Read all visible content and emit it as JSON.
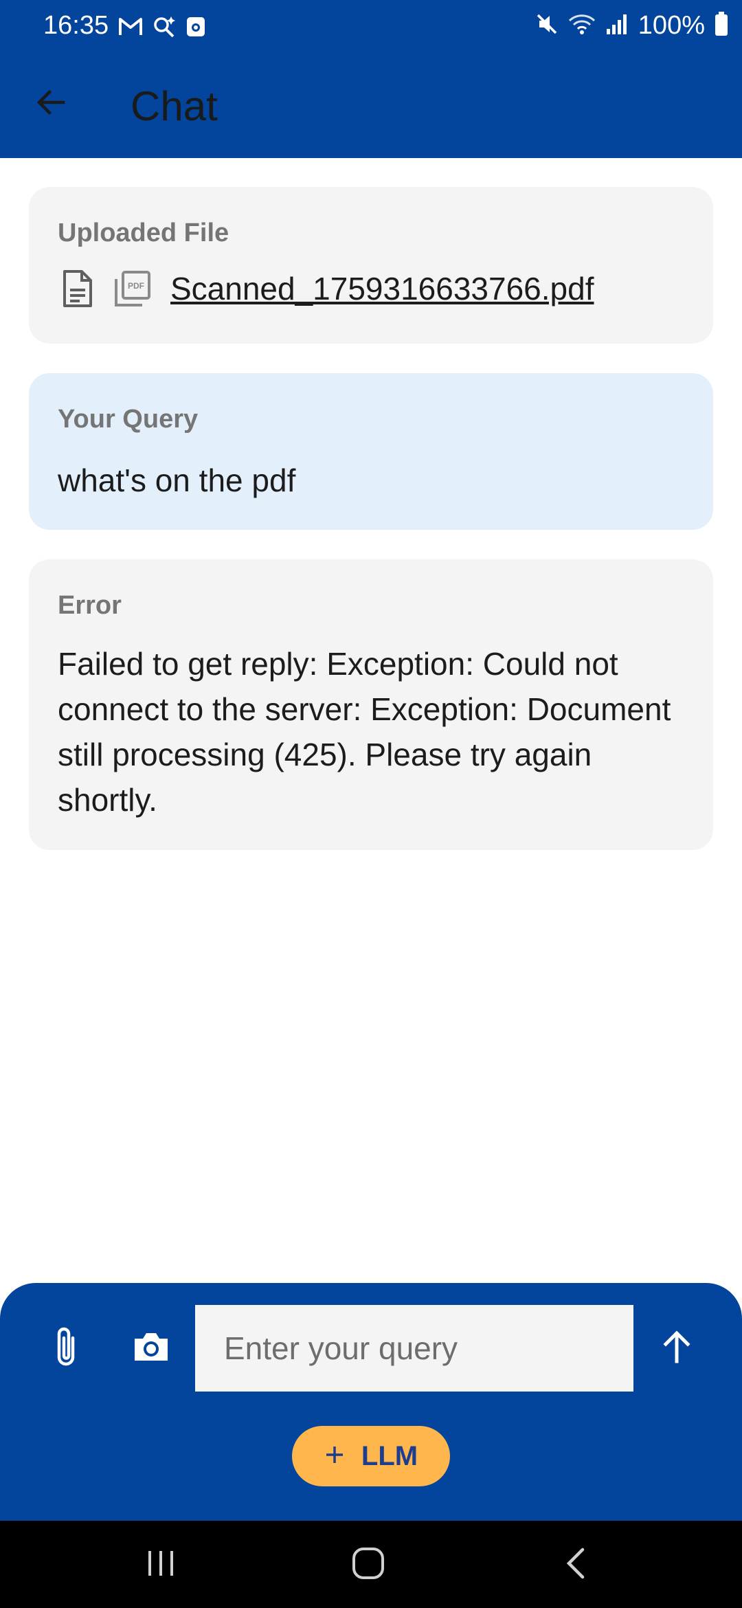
{
  "status_bar": {
    "time": "16:35",
    "left_icons": [
      "gmail-icon",
      "search-sparkle-icon",
      "screen-record-icon"
    ],
    "right_icons": [
      "mute-icon",
      "wifi-icon",
      "signal-icon"
    ],
    "battery": "100%"
  },
  "app_bar": {
    "title": "Chat",
    "back_icon": "arrow-left-icon"
  },
  "uploaded_file": {
    "label": "Uploaded File",
    "file_name": "Scanned_1759316633766.pdf",
    "icons": [
      "document-icon",
      "pdf-icon"
    ]
  },
  "query": {
    "label": "Your Query",
    "text": "what's on the pdf"
  },
  "error": {
    "label": "Error",
    "text": "Failed to get reply: Exception: Could not connect to the server: Exception: Document still processing (425). Please try again shortly."
  },
  "input_panel": {
    "placeholder": "Enter your query",
    "value": "",
    "attach_icon": "paperclip-icon",
    "camera_icon": "camera-icon",
    "send_icon": "arrow-up-icon",
    "llm_button_label": "LLM",
    "llm_button_icon": "plus-icon"
  },
  "colors": {
    "primary": "#03449c",
    "query_bg": "#e3f0fc",
    "card_bg": "#f4f4f4",
    "accent": "#ffb74d"
  }
}
